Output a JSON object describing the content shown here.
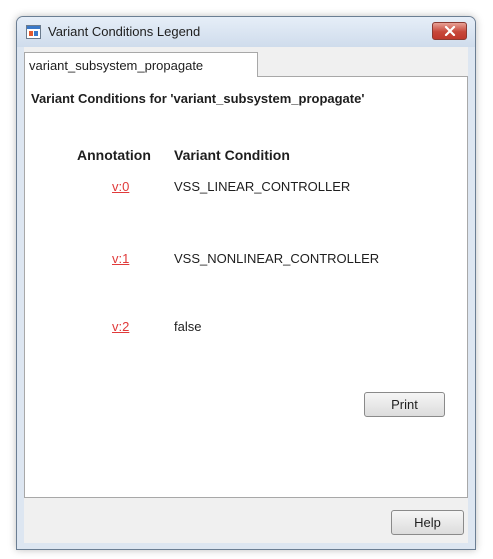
{
  "window": {
    "title": "Variant Conditions Legend",
    "app_icon": "simulink-legend-icon",
    "close_icon": "close-icon"
  },
  "tab": {
    "label": "variant_subsystem_propagate"
  },
  "legend": {
    "heading": "Variant Conditions for 'variant_subsystem_propagate'",
    "columns": {
      "annotation": "Annotation",
      "condition": "Variant Condition"
    },
    "rows": [
      {
        "annotation": "v:0",
        "condition": "VSS_LINEAR_CONTROLLER"
      },
      {
        "annotation": "v:1",
        "condition": "VSS_NONLINEAR_CONTROLLER"
      },
      {
        "annotation": "v:2",
        "condition": "false"
      }
    ]
  },
  "buttons": {
    "print": "Print",
    "help": "Help"
  },
  "colors": {
    "annotation_link": "#e03a3a",
    "close_button": "#c7473a",
    "window_frame": "#dde6f1"
  }
}
